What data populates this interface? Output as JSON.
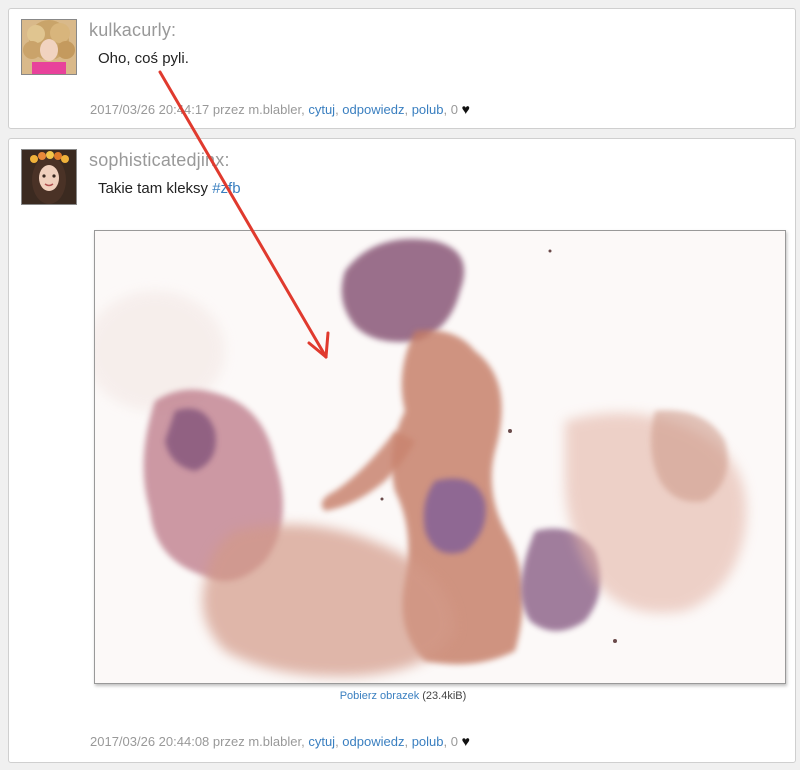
{
  "posts": [
    {
      "author": "kulkacurly:",
      "text": "Oho, coś pyli.",
      "meta": {
        "timestamp": "2017/03/26 20:44:17",
        "by_prefix": "przez",
        "by_user": "m.blabler,",
        "quote": "cytuj",
        "reply": "odpowiedz",
        "like": "polub",
        "likes": "0"
      },
      "avatar_icon": "curly-hair-avatar"
    },
    {
      "author": "sophisticatedjinx:",
      "text": "Takie tam kleksy",
      "link": "#zfb",
      "meta": {
        "timestamp": "2017/03/26 20:44:08",
        "by_prefix": "przez",
        "by_user": "m.blabler,",
        "quote": "cytuj",
        "reply": "odpowiedz",
        "like": "polub",
        "likes": "0"
      },
      "avatar_icon": "flower-crown-avatar",
      "image": {
        "download_label": "Pobierz obrazek",
        "size": "(23.4kiB)",
        "alt_icon": "watercolor-painting"
      }
    }
  ],
  "colors": {
    "link": "#3a7fc0",
    "muted": "#999999",
    "arrow": "#e03a2e",
    "card_border": "#cfcfcf"
  }
}
